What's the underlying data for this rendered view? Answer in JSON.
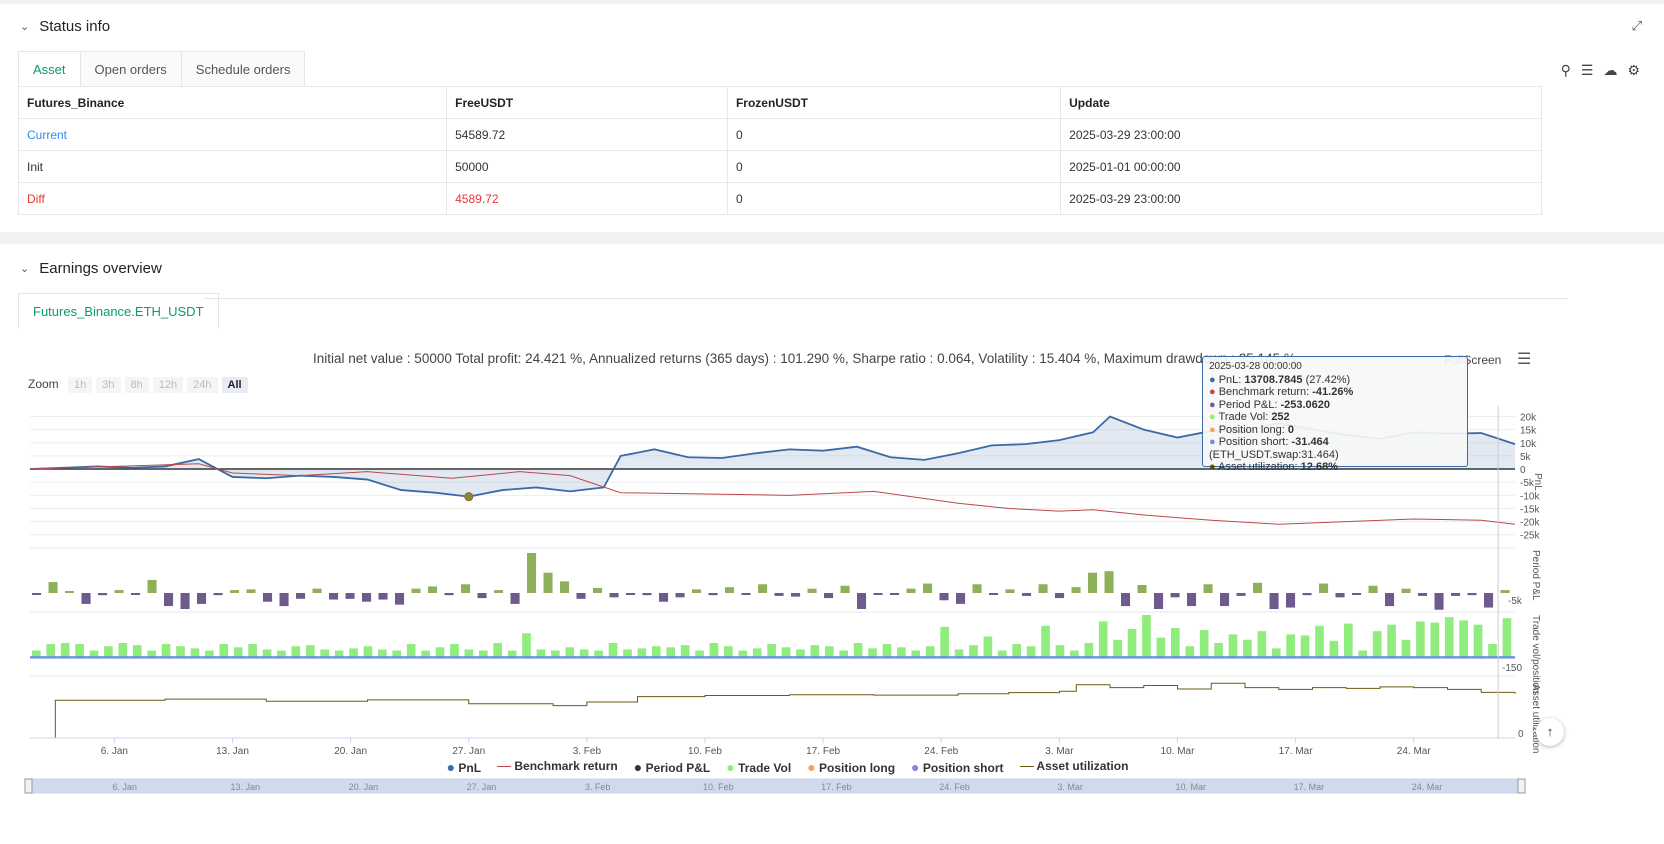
{
  "status": {
    "title": "Status info",
    "tabs": [
      "Asset",
      "Open orders",
      "Schedule orders"
    ],
    "columns": [
      "Futures_Binance",
      "FreeUSDT",
      "FrozenUSDT",
      "Update"
    ],
    "rows": [
      [
        "Current",
        "54589.72",
        "0",
        "2025-03-29 23:00:00"
      ],
      [
        "Init",
        "50000",
        "0",
        "2025-01-01 00:00:00"
      ],
      [
        "Diff",
        "4589.72",
        "0",
        "2025-03-29 23:00:00"
      ]
    ]
  },
  "earnings": {
    "title": "Earnings overview",
    "tab": "Futures_Binance.ETH_USDT",
    "summary": "Initial net value : 50000 Total profit: 24.421 %, Annualized returns (365 days) : 101.290 %, Sharpe ratio : 0.064, Volatility : 15.404 %, Maximum drawdown : 25.145 %",
    "fullscreen": "FullScreen",
    "zoom_label": "Zoom",
    "zoom_options": [
      "1h",
      "3h",
      "8h",
      "12h",
      "24h",
      "All"
    ],
    "tooltip": {
      "date": "2025-03-28 00:00:00",
      "lines": [
        {
          "label": "PnL: ",
          "value": "13708.7845",
          "extra": " (27.42%)",
          "color": "#3b6aa6"
        },
        {
          "label": "Benchmark return: ",
          "value": "-41.26%",
          "extra": "",
          "color": "#b84a4a"
        },
        {
          "label": "Period P&L: ",
          "value": "-253.0620",
          "extra": "",
          "color": "#7a5a99"
        },
        {
          "label": "Trade Vol: ",
          "value": "252",
          "extra": "",
          "color": "#90ed7d"
        },
        {
          "label": "Position long: ",
          "value": "0",
          "extra": "",
          "color": "#f7a35c"
        },
        {
          "label": "Position short: ",
          "value": "-31.464",
          "extra": " (ETH_USDT.swap:31.464)",
          "color": "#8085e9"
        },
        {
          "label": "Asset utilization: ",
          "value": "12.68%",
          "extra": "",
          "color": "#5c4b00"
        }
      ]
    },
    "legend": [
      {
        "name": "PnL",
        "color": "#3b6aa6",
        "type": "dot"
      },
      {
        "name": "Benchmark return",
        "color": "#b84a4a",
        "type": "line"
      },
      {
        "name": "Period P&L",
        "color": "#333333",
        "type": "dot"
      },
      {
        "name": "Trade Vol",
        "color": "#90ed7d",
        "type": "dot"
      },
      {
        "name": "Position long",
        "color": "#f7a35c",
        "type": "dot"
      },
      {
        "name": "Position short",
        "color": "#8085e9",
        "type": "dot"
      },
      {
        "name": "Asset utilization",
        "color": "#6b5a10",
        "type": "line"
      }
    ]
  },
  "chart_data": {
    "type": "line",
    "x_ticks": [
      "6. Jan",
      "13. Jan",
      "20. Jan",
      "27. Jan",
      "3. Feb",
      "10. Feb",
      "17. Feb",
      "24. Feb",
      "3. Mar",
      "10. Mar",
      "17. Mar",
      "24. Mar"
    ],
    "x_tick_days": [
      5,
      12,
      19,
      26,
      33,
      40,
      47,
      54,
      61,
      68,
      75,
      82
    ],
    "x_range_days": [
      0,
      88
    ],
    "pnl_axis": {
      "label": "PnL",
      "ticks": [
        "20k",
        "15k",
        "10k",
        "5k",
        "0",
        "-5k",
        "-10k",
        "-15k",
        "-20k",
        "-25k"
      ],
      "ylim": [
        -27000,
        24000
      ]
    },
    "pnl_days": [
      0,
      2,
      4,
      6,
      8,
      10,
      12,
      14,
      16,
      18,
      20,
      22,
      24,
      26,
      28,
      30,
      32,
      34,
      35,
      37,
      39,
      41,
      43,
      45,
      47,
      49,
      51,
      53,
      55,
      57,
      59,
      61,
      63,
      64,
      66,
      68,
      70,
      72,
      74,
      76,
      78,
      80,
      82,
      84,
      86,
      88
    ],
    "pnl": [
      0,
      500,
      1000,
      500,
      1000,
      3800,
      -3000,
      -3500,
      -2500,
      -3000,
      -4000,
      -8000,
      -9000,
      -10500,
      -8000,
      -7000,
      -8500,
      -7000,
      5000,
      7500,
      4500,
      4200,
      6000,
      7500,
      7000,
      8500,
      4500,
      3500,
      6000,
      9000,
      9500,
      11000,
      14000,
      20000,
      15000,
      12000,
      14500,
      14500,
      17500,
      15000,
      13000,
      11500,
      14000,
      13500,
      13700,
      9500
    ],
    "bench_days": [
      0,
      5,
      10,
      12,
      16,
      20,
      25,
      29,
      32,
      35,
      40,
      45,
      50,
      55,
      58,
      61,
      63,
      66,
      70,
      74,
      78,
      82,
      86,
      88
    ],
    "benchmark": [
      0,
      1000,
      2000,
      -1500,
      -2500,
      -1000,
      -3500,
      -1000,
      -2500,
      -9000,
      -9500,
      -10000,
      -8500,
      -13000,
      -15000,
      -16000,
      -15500,
      -17500,
      -19500,
      -21000,
      -20000,
      -19000,
      -19500,
      -21000
    ],
    "period_pnl_axis": {
      "label": "Period P&L",
      "ticks": [
        "-5k"
      ]
    },
    "period_pnl": [
      -200,
      1500,
      0,
      -1500,
      -300,
      400,
      -200,
      1800,
      -1800,
      -2200,
      -1500,
      -300,
      400,
      500,
      -1200,
      -1800,
      -800,
      600,
      -900,
      -800,
      -1200,
      -900,
      -1600,
      600,
      900,
      -300,
      1200,
      -700,
      400,
      -1500,
      5500,
      2800,
      1600,
      -800,
      700,
      -600,
      -200,
      -300,
      -1200,
      -600,
      500,
      -300,
      800,
      -200,
      1200,
      -400,
      -500,
      600,
      -700,
      1000,
      -2200,
      -200,
      -100,
      600,
      1300,
      -1000,
      -1500,
      1200,
      -200,
      500,
      -400,
      1200,
      -700,
      800,
      2800,
      3000,
      -1800,
      1100,
      -2200,
      -600,
      -1800,
      1200,
      -1800,
      -400,
      1400,
      -2200,
      -2000,
      -300,
      1300,
      -600,
      -200,
      1000,
      -1800,
      600,
      -400,
      -2300,
      -400,
      -300,
      -2000,
      400
    ],
    "trade_vol_axis": {
      "label": "Trade vol/position",
      "ticks": [
        "-150"
      ]
    },
    "trade_vol": [
      60,
      120,
      130,
      120,
      60,
      100,
      130,
      110,
      60,
      120,
      100,
      80,
      60,
      120,
      90,
      120,
      70,
      60,
      100,
      110,
      70,
      60,
      80,
      100,
      70,
      60,
      120,
      60,
      90,
      120,
      70,
      60,
      130,
      60,
      220,
      70,
      60,
      90,
      70,
      60,
      130,
      70,
      80,
      100,
      90,
      110,
      60,
      130,
      100,
      60,
      80,
      120,
      90,
      70,
      110,
      100,
      60,
      130,
      80,
      120,
      90,
      60,
      100,
      280,
      70,
      110,
      190,
      60,
      120,
      100,
      290,
      110,
      60,
      130,
      330,
      160,
      260,
      390,
      180,
      270,
      100,
      250,
      130,
      210,
      160,
      240,
      80,
      210,
      200,
      290,
      150,
      310,
      60,
      240,
      300,
      160,
      330,
      320,
      370,
      340,
      300,
      120,
      360
    ],
    "position_short": [
      -20,
      -20,
      -20,
      -20,
      -20,
      -20,
      -20,
      -20,
      -20,
      -20,
      -20,
      -20,
      -20,
      -20,
      -20,
      -20,
      -20,
      -20,
      -20,
      -20,
      -20,
      -20,
      -20,
      -20,
      -20,
      -20,
      -20,
      -20,
      -20,
      -20,
      -20,
      -20,
      -20,
      -20,
      -20,
      -20,
      -20,
      -20,
      -20,
      -20,
      -20,
      -20,
      -20,
      -20,
      -20,
      -20,
      -20,
      -20,
      -20,
      -20,
      -20,
      -20,
      -20,
      -20,
      -20,
      -20,
      -20,
      -20,
      -20,
      -20,
      -20,
      -20,
      -20,
      -20,
      -20,
      -20,
      -20,
      -20,
      -20,
      -20,
      -20,
      -20,
      -20,
      -20,
      -20,
      -20,
      -20,
      -20,
      -20,
      -20,
      -20,
      -20,
      -20,
      -20,
      -20,
      -20,
      -20,
      -20,
      -20,
      -20,
      -20,
      -20,
      -20,
      -20,
      -20,
      -20,
      -20,
      -20,
      -20,
      -20,
      -20,
      -20,
      -20
    ],
    "util_axis": {
      "label": "Asset utilization",
      "ticks": [
        "0"
      ]
    },
    "util_days": [
      0,
      1,
      1.5,
      8,
      14,
      20,
      26,
      31,
      33,
      36,
      40,
      45,
      50,
      55,
      58,
      61,
      62,
      64,
      66,
      68,
      70,
      72,
      74,
      76,
      78,
      80,
      82,
      84,
      86,
      88
    ],
    "utilization": [
      0,
      0,
      10.5,
      10.8,
      10.2,
      10.6,
      9.5,
      9.0,
      10.0,
      11.5,
      11.8,
      12.0,
      11.9,
      12.3,
      12.6,
      13.0,
      14.8,
      14.0,
      14.6,
      13.6,
      15.2,
      14.0,
      13.5,
      14.0,
      13.8,
      14.2,
      14.0,
      13.5,
      12.68,
      12.3
    ],
    "navigator_ticks": [
      "6. Jan",
      "13. Jan",
      "20. Jan",
      "27. Jan",
      "3. Feb",
      "10. Feb",
      "17. Feb",
      "24. Feb",
      "3. Mar",
      "10. Mar",
      "17. Mar",
      "24. Mar"
    ]
  },
  "colors": {
    "pnl": "#3b6aa6",
    "benchmark": "#b84a4a",
    "pos": "#8fb05a",
    "neg": "#6f5a8e",
    "vol": "#90ed7d",
    "short": "#8085e9",
    "long": "#f7a35c",
    "util": "#6b5a10",
    "accent": "#0a9e6a"
  }
}
